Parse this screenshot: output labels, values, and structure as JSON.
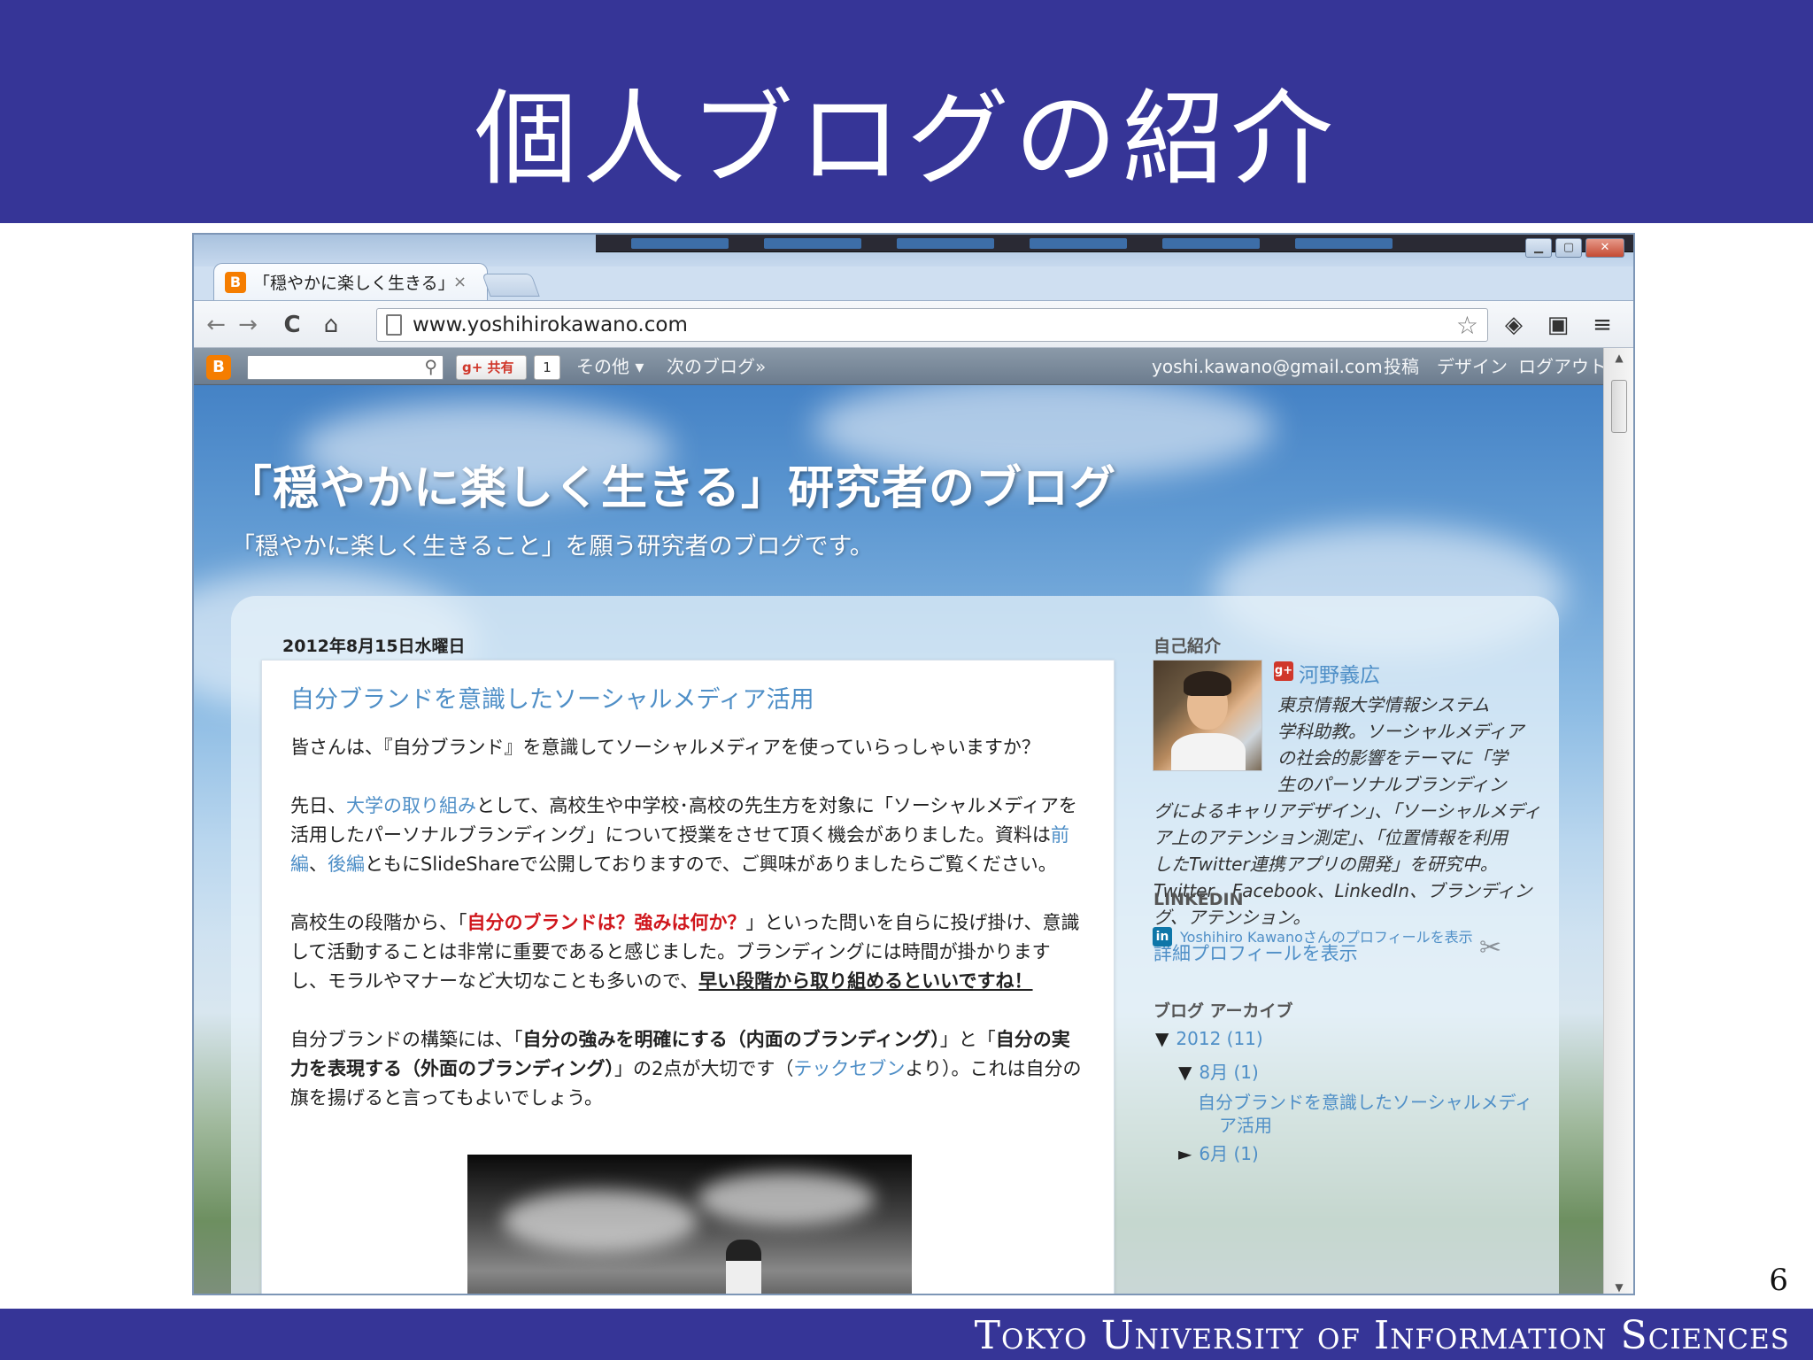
{
  "slide": {
    "title": "個人ブログの紹介",
    "footer": "Tokyo University of Information Sciences",
    "page_number": "6"
  },
  "browser": {
    "tab_title": "「穏やかに楽しく生きる」",
    "tab_close": "×",
    "url": "www.yoshihirokawano.com",
    "icons": {
      "back": "back-arrow-icon",
      "forward": "forward-arrow-icon",
      "reload": "reload-icon",
      "home": "home-icon",
      "bookmark": "star-icon",
      "buffer": "layers-icon",
      "evernote": "evernote-icon",
      "menu": "hamburger-menu-icon"
    },
    "glyphs": {
      "back": "←",
      "forward": "→",
      "reload": "C",
      "home": "⌂",
      "star": "☆",
      "layers": "◈",
      "evernote": "▣",
      "menu": "≡",
      "search": "⚲",
      "wrench": "✂",
      "scroll_up": "▲",
      "scroll_down": "▼"
    }
  },
  "blogger_bar": {
    "logo": "B",
    "share_label": "共有",
    "gplus_prefix": "g+",
    "share_count": "1",
    "more": "その他 ▾",
    "next_blog": "次のブログ»",
    "email": "yoshi.kawano@gmail.com",
    "post": "投稿",
    "design": "デザイン",
    "logout": "ログアウト"
  },
  "blog": {
    "title": "「穏やかに楽しく生きる」研究者のブログ",
    "description": "「穏やかに楽しく生きること」を願う研究者のブログです。",
    "post_date": "2012年8月15日水曜日",
    "post_title": "自分ブランドを意識したソーシャルメディア活用",
    "para1": "皆さんは、『自分ブランド』を意識してソーシャルメディアを使っていらっしゃいますか？",
    "para2": {
      "t1": "先日、",
      "link1": "大学の取り組み",
      "t2": "として、高校生や中学校･高校の先生方を対象に「ソーシャルメディアを活用したパーソナルブランディング」について授業をさせて頂く機会がありました。資料は",
      "link2": "前編",
      "t3": "、",
      "link3": "後編",
      "t4": "ともにSlideShareで公開しておりますので、ご興味がありましたらご覧ください。"
    },
    "para3": {
      "t1": "高校生の段階から、「",
      "red": "自分のブランドは？強みは何か？",
      "t2": "」といった問いを自らに投げ掛け、意識して活動することは非常に重要であると感じました。ブランディングには時間が掛かりますし、モラルやマナーなど大切なことも多いので、",
      "bold_ul": "早い段階から取り組めるといいですね！"
    },
    "para4": {
      "t1": "自分ブランドの構築には、「",
      "b1": "自分の強みを明確にする（内面のブランディング）",
      "t2": "」と「",
      "b2": "自分の実力を表現する（外面のブランディング）",
      "t3": "」の2点が大切です（",
      "link": "テックセブン",
      "t4": "より）。これは自分の旗を揚げると言ってもよいでしょう。"
    }
  },
  "sidebar": {
    "profile_heading": "自己紹介",
    "gplus_badge": "g+",
    "author_name": "河野義広",
    "bio_lines": [
      "東京情報大学情報システム",
      "学科助教。ソーシャルメディア",
      "の社会的影響をテーマに「学",
      "生のパーソナルブランディン",
      "グによるキャリアデザイン」、「ソーシャルメディ",
      "ア上のアテンション測定」、「位置情報を利用",
      "したTwitter連携アプリの開発」を研究中。",
      "Twitter、Facebook、LinkedIn、ブランディン",
      "グ、アテンション。"
    ],
    "profile_link": "詳細プロフィールを表示",
    "linkedin_heading": "LINKEDIN",
    "linkedin_badge": "in",
    "linkedin_link": "Yoshihiro Kawanoさんのプロフィールを表示",
    "archive_heading": "ブログ アーカイブ",
    "archive_year": "2012 (11)",
    "archive_month": "8月 (1)",
    "archive_post_line1": "自分ブランドを意識したソーシャルメディ",
    "archive_post_line2": "ア活用",
    "archive_next": "6月 (1)",
    "toggle_open": "▼",
    "toggle_closed": "►"
  },
  "colors": {
    "slide_band": "#363597",
    "link_blue": "#4f8fc7",
    "emphasis_red": "#d0171d",
    "blogger_orange": "#f57d00"
  }
}
